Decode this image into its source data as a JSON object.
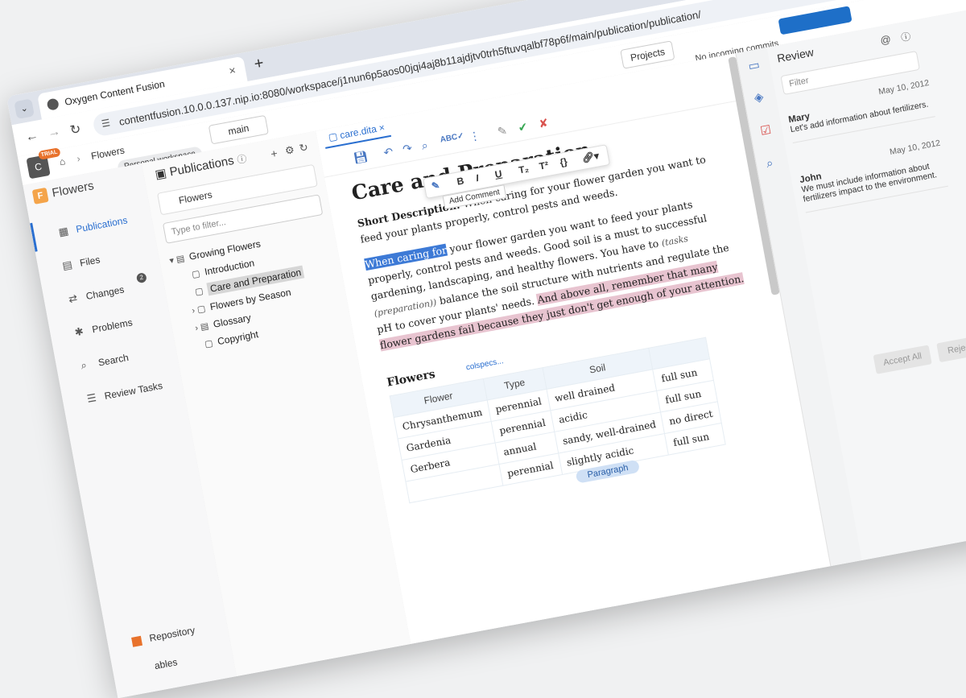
{
  "browser": {
    "tab_title": "Oxygen Content Fusion",
    "url": "contentfusion.10.0.0.137.nip.io:8080/workspace/j1nun6p5aos00jqi4aj8b11ajdjtv0trh5ftuvqalbf78p6f/main/publication/publication/"
  },
  "appbar": {
    "avatar_letter": "C",
    "trial": "TRIAL",
    "crumb": "Flowers",
    "branch": "main",
    "workspace": "Personal workspace",
    "projects": "Projects",
    "commits": "No incoming commits"
  },
  "leftnav": {
    "brand": "Flowers",
    "items": [
      {
        "label": "Publications"
      },
      {
        "label": "Files"
      },
      {
        "label": "Changes",
        "badge": "2"
      },
      {
        "label": "Problems"
      },
      {
        "label": "Search"
      },
      {
        "label": "Review Tasks"
      }
    ],
    "repository": "Repository",
    "cut_label": "ables"
  },
  "publications": {
    "title": "Publications",
    "selected": "Flowers",
    "filter_placeholder": "Type to filter...",
    "tree": [
      "Growing Flowers",
      "Introduction",
      "Care and Preparation",
      "Flowers by Season",
      "Glossary",
      "Copyright"
    ]
  },
  "editor": {
    "file_tab": "care.dita",
    "title": "Care and Preparation",
    "short_desc_label": "Short Description:",
    "short_desc": "When caring for your flower garden you want to feed your plants properly, control pests and weeds.",
    "para_highlight": "When caring for",
    "para_rest": " your flower garden you want to feed your plants properly, control pests and weeds. Good soil is a must to successful gardening, landscaping, and healthy flowers. You have to ",
    "para_tags": "(tasks (preparation))",
    "para_balance": "balance the soil structure with nutrients and regulate the pH to cover your plants' needs. ",
    "para_pink": "And above all, remember that many flower gardens fail because they just don't get enough of your attention.",
    "tooltip": "Add Comment",
    "table_title": "Flowers",
    "colspecs": "colspecs...",
    "table_headers": [
      "Flower",
      "Type",
      "Soil",
      ""
    ],
    "table_rows": [
      [
        "Chrysanthemum",
        "perennial",
        "well drained",
        "full sun"
      ],
      [
        "Gardenia",
        "perennial",
        "acidic",
        "full sun"
      ],
      [
        "Gerbera",
        "annual",
        "sandy, well-drained",
        "no direct"
      ],
      [
        "",
        "perennial",
        "slightly acidic",
        "full sun"
      ]
    ],
    "paragraph_tag": "Paragraph"
  },
  "review": {
    "title": "Review",
    "filter_placeholder": "Filter",
    "comments": [
      {
        "author": "Mary",
        "date": "May 10, 2012",
        "text": "Let's add information about fertilizers."
      },
      {
        "author": "John",
        "date": "May 10, 2012",
        "text": "We must include information about fertilizers impact to the environment."
      }
    ],
    "accept_all": "Accept All",
    "reject_all": "Reject All"
  }
}
